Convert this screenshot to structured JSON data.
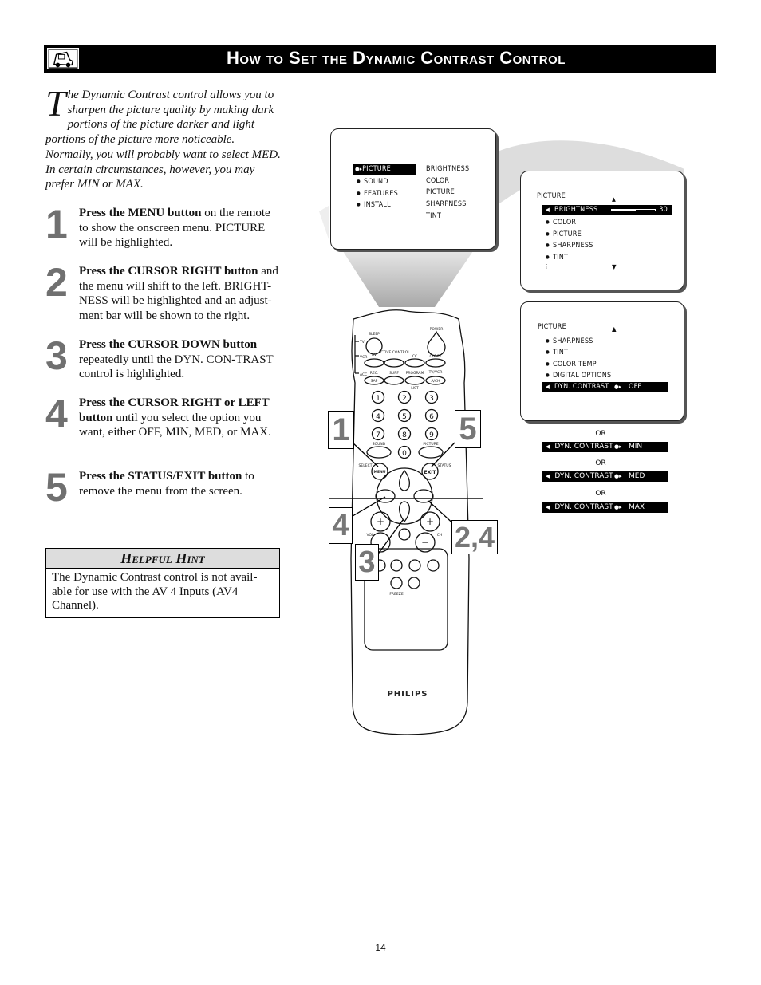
{
  "header": {
    "title": "How to Set the Dynamic Contrast Control",
    "icon": "tv-remote-icon"
  },
  "intro": {
    "dropcap": "T",
    "text": "he Dynamic Contrast control allows you to sharpen the picture quality by making dark portions of the picture darker and light portions of the picture more noticeable. Normally, you will probably want to select MED. In certain circumstances, however, you may prefer MIN or MAX."
  },
  "steps": [
    {
      "number": "1",
      "bold": "Press the MENU button",
      "text": " on the remote to show the onscreen menu. PICTURE will be highlighted."
    },
    {
      "number": "2",
      "bold": "Press the CURSOR RIGHT button",
      "text": " and the menu will shift to the left. BRIGHT-NESS will be highlighted and an adjust-ment bar will be shown to the right."
    },
    {
      "number": "3",
      "bold": "Press the CURSOR DOWN button",
      "text": " repeatedly until the DYN. CON-TRAST control is highlighted."
    },
    {
      "number": "4",
      "bold": "Press the CURSOR RIGHT or LEFT button",
      "text": " until you select the option you want, either OFF, MIN, MED, or MAX."
    },
    {
      "number": "5",
      "bold": "Press the STATUS/EXIT button",
      "text": " to remove the menu from the screen."
    }
  ],
  "hint": {
    "title": "Helpful Hint",
    "text": "The Dynamic Contrast control is not avail-able for use with the AV 4 Inputs (AV4 Channel)."
  },
  "screen1": {
    "main_menu": [
      "PICTURE",
      "SOUND",
      "FEATURES",
      "INSTALL"
    ],
    "sub_menu": [
      "BRIGHTNESS",
      "COLOR",
      "PICTURE",
      "SHARPNESS",
      "TINT"
    ]
  },
  "screen2": {
    "title": "PICTURE",
    "items": [
      "BRIGHTNESS",
      "COLOR",
      "PICTURE",
      "SHARPNESS",
      "TINT"
    ],
    "brightness_value": "30",
    "brightness_level": 0.55
  },
  "screen3": {
    "title": "PICTURE",
    "items": [
      "SHARPNESS",
      "TINT",
      "COLOR TEMP",
      "DIGITAL OPTIONS"
    ],
    "selected_label": "DYN. CONTRAST",
    "selected_value": "OFF"
  },
  "options": {
    "or_label": "OR",
    "label": "DYN. CONTRAST",
    "values": [
      "MIN",
      "MED",
      "MAX"
    ]
  },
  "remote": {
    "brand": "PHILIPS",
    "labels": {
      "sleep": "SLEEP",
      "power": "POWER",
      "tv": "TV",
      "vcr": "VCR",
      "acc": "ACC",
      "av": "AV",
      "active_control": "ACTIVE CONTROL",
      "cc": "CC",
      "clock": "CLOCK",
      "rec": "REC.",
      "sap": "SAP",
      "surf": "SURF",
      "program": "PROGRAM",
      "list": "LIST",
      "tvvcr": "TV/VCR",
      "ach": "A/CH",
      "sound": "SOUND",
      "picture": "PICTURE",
      "select": "SELECT",
      "menu": "MENU",
      "exit": "EXIT",
      "status": "STATUS",
      "vol": "VOL",
      "ch": "CH",
      "freeze": "FREEZE"
    },
    "digits": [
      "1",
      "2",
      "3",
      "4",
      "5",
      "6",
      "7",
      "8",
      "9",
      "0"
    ]
  },
  "callouts": [
    "1",
    "5",
    "4",
    "2,4",
    "3"
  ],
  "page_number": "14"
}
